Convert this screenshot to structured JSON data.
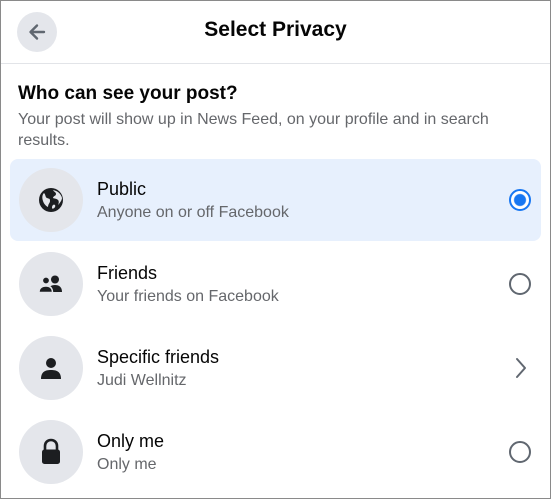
{
  "header": {
    "back_icon": "arrow-left-icon",
    "title": "Select Privacy"
  },
  "prompt": {
    "question": "Who can see your post?",
    "description": "Your post will show up in News Feed, on your profile and in search results."
  },
  "options": [
    {
      "title": "Public",
      "subtitle": "Anyone on or off Facebook",
      "icon": "globe-icon",
      "control": "radio",
      "selected": true
    },
    {
      "title": "Friends",
      "subtitle": "Your friends on Facebook",
      "icon": "friends-icon",
      "control": "radio",
      "selected": false
    },
    {
      "title": "Specific friends",
      "subtitle": "Judi Wellnitz",
      "icon": "person-icon",
      "control": "chevron",
      "selected": false
    },
    {
      "title": "Only me",
      "subtitle": "Only me",
      "icon": "lock-icon",
      "control": "radio",
      "selected": false
    }
  ],
  "colors": {
    "accent": "#1877f2",
    "selected_background": "#e7f0fd",
    "icon_background": "#e4e6eb"
  }
}
